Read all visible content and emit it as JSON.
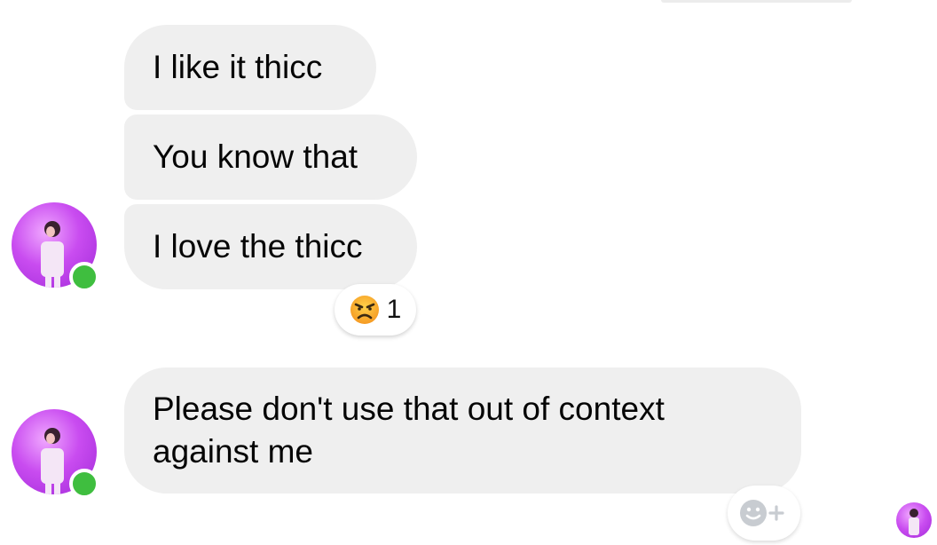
{
  "conversation": {
    "messages": [
      {
        "text": "I like it thicc"
      },
      {
        "text": "You know that"
      },
      {
        "text": "I love the thicc"
      },
      {
        "text": "Please don't use that out of context against me"
      }
    ],
    "reaction": {
      "emoji": "angry-face",
      "count": "1"
    },
    "sender_status": "online"
  },
  "colors": {
    "bubble": "#efefef",
    "presence": "#3fbe3f",
    "avatar_accent": "#c94cf0"
  }
}
